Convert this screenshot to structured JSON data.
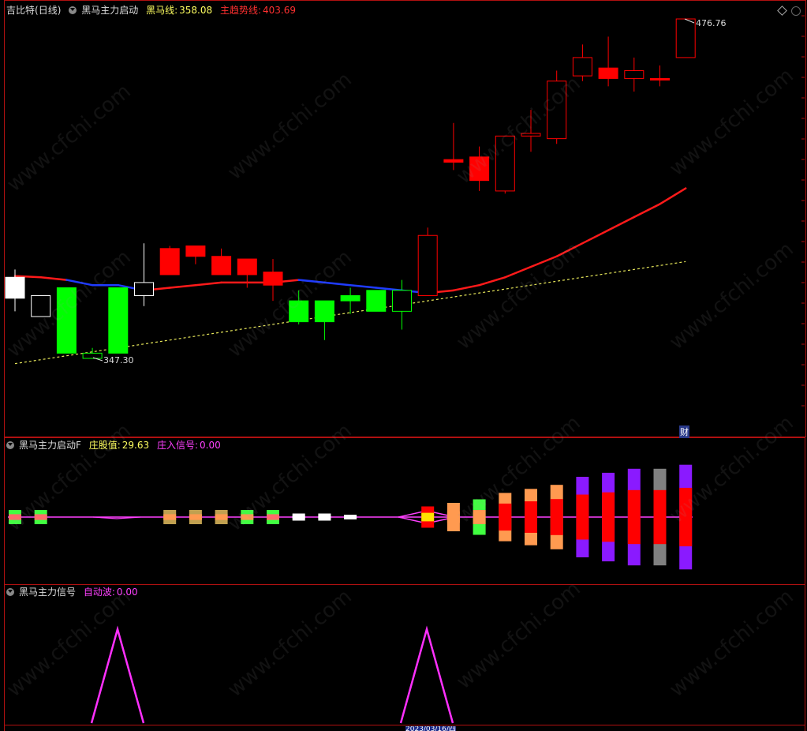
{
  "main_panel": {
    "symbol": "吉比特",
    "period": "(日线)",
    "indicator_name": "黑马主力启动",
    "line1_label": "黑马线:",
    "line1_value": "358.08",
    "line2_label": "主趋势线:",
    "line2_value": "403.69",
    "high_label": "476.76",
    "low_label": "347.30",
    "badge": "财",
    "colors": {
      "up": "#ff0000",
      "down": "#00ff00",
      "neutral": "#ffffff",
      "trend_red": "#ff1a1a",
      "trend_blue": "#1f3bff",
      "dotted": "#e8e85a"
    }
  },
  "sub_panel1": {
    "title": "黑马主力启动F",
    "val1_label": "庄股值:",
    "val1_value": "29.63",
    "val2_label": "庄入信号:",
    "val2_value": "0.00"
  },
  "sub_panel2": {
    "title": "黑马主力信号",
    "val_label": "自动波:",
    "val_value": "0.00"
  },
  "bottom_axis": {
    "date_label": "2023/03/16/四"
  },
  "chart_data": {
    "type": "candlestick",
    "high_marker": 476.76,
    "low_marker": 347.3,
    "candles": [
      {
        "o": 370,
        "c": 378,
        "h": 381,
        "l": 365,
        "dir": "neutral"
      },
      {
        "o": 371,
        "c": 363,
        "h": 371,
        "l": 363,
        "dir": "neutral"
      },
      {
        "o": 374,
        "c": 349,
        "h": 374,
        "l": 349,
        "dir": "down"
      },
      {
        "o": 347,
        "c": 349,
        "h": 351,
        "l": 347.3,
        "dir": "down"
      },
      {
        "o": 374,
        "c": 349,
        "h": 374,
        "l": 349,
        "dir": "down"
      },
      {
        "o": 376,
        "c": 371,
        "h": 391,
        "l": 367,
        "dir": "neutral"
      },
      {
        "o": 389,
        "c": 379,
        "h": 390,
        "l": 379,
        "dir": "up"
      },
      {
        "o": 390,
        "c": 386,
        "h": 390,
        "l": 383,
        "dir": "up"
      },
      {
        "o": 386,
        "c": 379,
        "h": 389,
        "l": 379,
        "dir": "up"
      },
      {
        "o": 385,
        "c": 379,
        "h": 385,
        "l": 374,
        "dir": "up"
      },
      {
        "o": 380,
        "c": 375,
        "h": 385,
        "l": 369,
        "dir": "up"
      },
      {
        "o": 369,
        "c": 361,
        "h": 373,
        "l": 360,
        "dir": "down"
      },
      {
        "o": 369,
        "c": 361,
        "h": 369,
        "l": 354,
        "dir": "down"
      },
      {
        "o": 371,
        "c": 369,
        "h": 374,
        "l": 364,
        "dir": "down"
      },
      {
        "o": 373,
        "c": 365,
        "h": 373,
        "l": 365,
        "dir": "down"
      },
      {
        "o": 365,
        "c": 373,
        "h": 377,
        "l": 358,
        "dir": "down"
      },
      {
        "o": 371,
        "c": 394,
        "h": 397,
        "l": 371,
        "dir": "up"
      },
      {
        "o": 423,
        "c": 422,
        "h": 437,
        "l": 419,
        "dir": "up"
      },
      {
        "o": 424,
        "c": 415,
        "h": 428,
        "l": 411,
        "dir": "up"
      },
      {
        "o": 411,
        "c": 432,
        "h": 432,
        "l": 410,
        "dir": "up"
      },
      {
        "o": 432,
        "c": 433,
        "h": 442,
        "l": 426,
        "dir": "up"
      },
      {
        "o": 431,
        "c": 453,
        "h": 457,
        "l": 429,
        "dir": "up"
      },
      {
        "o": 455,
        "c": 462,
        "h": 467,
        "l": 453,
        "dir": "up"
      },
      {
        "o": 458,
        "c": 454,
        "h": 470,
        "l": 451,
        "dir": "up"
      },
      {
        "o": 454,
        "c": 457,
        "h": 462,
        "l": 449,
        "dir": "up"
      },
      {
        "o": 454,
        "c": 454,
        "h": 459,
        "l": 451,
        "dir": "up"
      },
      {
        "o": 462,
        "c": 476.76,
        "h": 476.76,
        "l": 462,
        "dir": "up"
      }
    ],
    "trend_line": [
      378.5,
      378,
      377,
      375,
      375,
      373,
      374,
      375,
      376,
      376,
      376,
      377,
      376,
      375,
      374,
      373,
      372,
      373,
      375,
      378,
      382,
      386,
      391,
      396,
      401,
      406,
      412
    ],
    "dotted_line": [
      345,
      346.5,
      348,
      349.5,
      351,
      352.5,
      354,
      355.5,
      357,
      358.5,
      360,
      361.5,
      363,
      364.5,
      366,
      367.5,
      369,
      370.5,
      372,
      373.5,
      375,
      376.5,
      378,
      379.5,
      381,
      382.5,
      384
    ],
    "f_bars": [
      {
        "h": 1,
        "cols": [
          "#ff6a6a",
          "#40ff40"
        ]
      },
      {
        "h": 1,
        "cols": [
          "#ff6a6a",
          "#40ff40"
        ]
      },
      {
        "h": 0,
        "cols": []
      },
      {
        "h": 0,
        "cols": []
      },
      {
        "h": 0,
        "cols": []
      },
      {
        "h": 0,
        "cols": []
      },
      {
        "h": 1,
        "cols": [
          "#ff9a50",
          "#c0a050"
        ]
      },
      {
        "h": 1,
        "cols": [
          "#ff9a50",
          "#c0a050"
        ]
      },
      {
        "h": 1,
        "cols": [
          "#ff9a50",
          "#c0a050"
        ]
      },
      {
        "h": 1,
        "cols": [
          "#ff9a50",
          "#40ff40"
        ]
      },
      {
        "h": 1,
        "cols": [
          "#ff6a6a",
          "#40ff40"
        ]
      },
      {
        "h": 0.5,
        "cols": [
          "#ffffff"
        ]
      },
      {
        "h": 0.5,
        "cols": [
          "#ffffff"
        ]
      },
      {
        "h": 0.3,
        "cols": [
          "#ffffff"
        ]
      },
      {
        "h": 0,
        "cols": []
      },
      {
        "h": 0,
        "cols": []
      },
      {
        "h": 1.5,
        "cols": [
          "#ffe000",
          "#ff0000"
        ]
      },
      {
        "h": 2,
        "cols": [
          "#ff9a50"
        ]
      },
      {
        "h": 2.5,
        "cols": [
          "#ff9a50",
          "#40ff40"
        ]
      },
      {
        "h": 3,
        "cols": [
          "#ff0000",
          "#ff9a50"
        ]
      },
      {
        "h": 3.5,
        "cols": [
          "#ff0000",
          "#ff9a50"
        ]
      },
      {
        "h": 4,
        "cols": [
          "#ff0000",
          "#ff9a50"
        ]
      },
      {
        "h": 5,
        "cols": [
          "#ff0000",
          "#8a1aff"
        ]
      },
      {
        "h": 5.5,
        "cols": [
          "#ff0000",
          "#8a1aff"
        ]
      },
      {
        "h": 6,
        "cols": [
          "#ff0000",
          "#8a1aff"
        ]
      },
      {
        "h": 6,
        "cols": [
          "#ff0000",
          "#808080"
        ]
      },
      {
        "h": 6.5,
        "cols": [
          "#ff0000",
          "#8a1aff"
        ]
      }
    ],
    "signal_peaks": [
      4,
      16
    ]
  }
}
